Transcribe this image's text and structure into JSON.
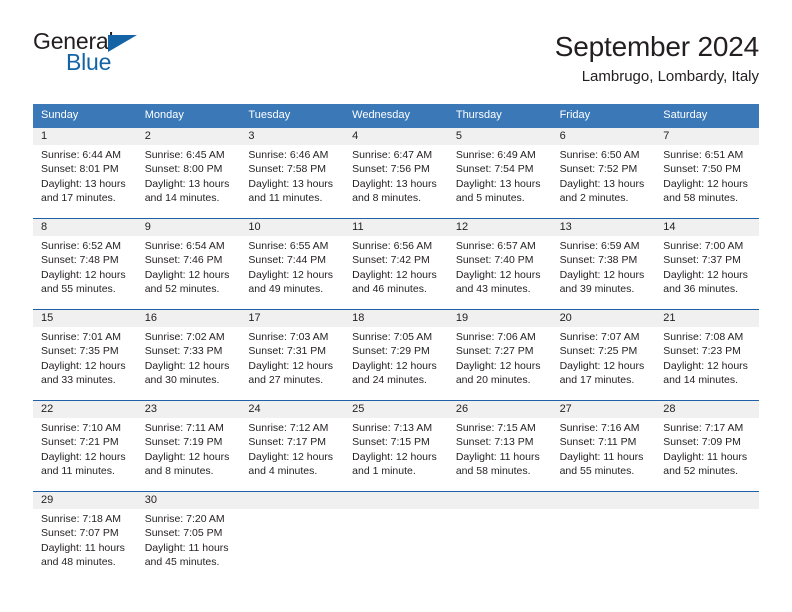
{
  "brand": {
    "word_one": "General",
    "word_two": "Blue",
    "triangle_color": "#1464a5"
  },
  "header": {
    "title": "September 2024",
    "subtitle": "Lambrugo, Lombardy, Italy"
  },
  "theme": {
    "header_row_bg": "#3a78b8",
    "week_divider": "#1f60a8",
    "daynum_band_bg": "#f0f0f0",
    "text": "#231f20"
  },
  "weekdays": [
    "Sunday",
    "Monday",
    "Tuesday",
    "Wednesday",
    "Thursday",
    "Friday",
    "Saturday"
  ],
  "weeks": [
    [
      {
        "day": "1",
        "sunrise": "Sunrise: 6:44 AM",
        "sunset": "Sunset: 8:01 PM",
        "daylight_1": "Daylight: 13 hours",
        "daylight_2": "and 17 minutes."
      },
      {
        "day": "2",
        "sunrise": "Sunrise: 6:45 AM",
        "sunset": "Sunset: 8:00 PM",
        "daylight_1": "Daylight: 13 hours",
        "daylight_2": "and 14 minutes."
      },
      {
        "day": "3",
        "sunrise": "Sunrise: 6:46 AM",
        "sunset": "Sunset: 7:58 PM",
        "daylight_1": "Daylight: 13 hours",
        "daylight_2": "and 11 minutes."
      },
      {
        "day": "4",
        "sunrise": "Sunrise: 6:47 AM",
        "sunset": "Sunset: 7:56 PM",
        "daylight_1": "Daylight: 13 hours",
        "daylight_2": "and 8 minutes."
      },
      {
        "day": "5",
        "sunrise": "Sunrise: 6:49 AM",
        "sunset": "Sunset: 7:54 PM",
        "daylight_1": "Daylight: 13 hours",
        "daylight_2": "and 5 minutes."
      },
      {
        "day": "6",
        "sunrise": "Sunrise: 6:50 AM",
        "sunset": "Sunset: 7:52 PM",
        "daylight_1": "Daylight: 13 hours",
        "daylight_2": "and 2 minutes."
      },
      {
        "day": "7",
        "sunrise": "Sunrise: 6:51 AM",
        "sunset": "Sunset: 7:50 PM",
        "daylight_1": "Daylight: 12 hours",
        "daylight_2": "and 58 minutes."
      }
    ],
    [
      {
        "day": "8",
        "sunrise": "Sunrise: 6:52 AM",
        "sunset": "Sunset: 7:48 PM",
        "daylight_1": "Daylight: 12 hours",
        "daylight_2": "and 55 minutes."
      },
      {
        "day": "9",
        "sunrise": "Sunrise: 6:54 AM",
        "sunset": "Sunset: 7:46 PM",
        "daylight_1": "Daylight: 12 hours",
        "daylight_2": "and 52 minutes."
      },
      {
        "day": "10",
        "sunrise": "Sunrise: 6:55 AM",
        "sunset": "Sunset: 7:44 PM",
        "daylight_1": "Daylight: 12 hours",
        "daylight_2": "and 49 minutes."
      },
      {
        "day": "11",
        "sunrise": "Sunrise: 6:56 AM",
        "sunset": "Sunset: 7:42 PM",
        "daylight_1": "Daylight: 12 hours",
        "daylight_2": "and 46 minutes."
      },
      {
        "day": "12",
        "sunrise": "Sunrise: 6:57 AM",
        "sunset": "Sunset: 7:40 PM",
        "daylight_1": "Daylight: 12 hours",
        "daylight_2": "and 43 minutes."
      },
      {
        "day": "13",
        "sunrise": "Sunrise: 6:59 AM",
        "sunset": "Sunset: 7:38 PM",
        "daylight_1": "Daylight: 12 hours",
        "daylight_2": "and 39 minutes."
      },
      {
        "day": "14",
        "sunrise": "Sunrise: 7:00 AM",
        "sunset": "Sunset: 7:37 PM",
        "daylight_1": "Daylight: 12 hours",
        "daylight_2": "and 36 minutes."
      }
    ],
    [
      {
        "day": "15",
        "sunrise": "Sunrise: 7:01 AM",
        "sunset": "Sunset: 7:35 PM",
        "daylight_1": "Daylight: 12 hours",
        "daylight_2": "and 33 minutes."
      },
      {
        "day": "16",
        "sunrise": "Sunrise: 7:02 AM",
        "sunset": "Sunset: 7:33 PM",
        "daylight_1": "Daylight: 12 hours",
        "daylight_2": "and 30 minutes."
      },
      {
        "day": "17",
        "sunrise": "Sunrise: 7:03 AM",
        "sunset": "Sunset: 7:31 PM",
        "daylight_1": "Daylight: 12 hours",
        "daylight_2": "and 27 minutes."
      },
      {
        "day": "18",
        "sunrise": "Sunrise: 7:05 AM",
        "sunset": "Sunset: 7:29 PM",
        "daylight_1": "Daylight: 12 hours",
        "daylight_2": "and 24 minutes."
      },
      {
        "day": "19",
        "sunrise": "Sunrise: 7:06 AM",
        "sunset": "Sunset: 7:27 PM",
        "daylight_1": "Daylight: 12 hours",
        "daylight_2": "and 20 minutes."
      },
      {
        "day": "20",
        "sunrise": "Sunrise: 7:07 AM",
        "sunset": "Sunset: 7:25 PM",
        "daylight_1": "Daylight: 12 hours",
        "daylight_2": "and 17 minutes."
      },
      {
        "day": "21",
        "sunrise": "Sunrise: 7:08 AM",
        "sunset": "Sunset: 7:23 PM",
        "daylight_1": "Daylight: 12 hours",
        "daylight_2": "and 14 minutes."
      }
    ],
    [
      {
        "day": "22",
        "sunrise": "Sunrise: 7:10 AM",
        "sunset": "Sunset: 7:21 PM",
        "daylight_1": "Daylight: 12 hours",
        "daylight_2": "and 11 minutes."
      },
      {
        "day": "23",
        "sunrise": "Sunrise: 7:11 AM",
        "sunset": "Sunset: 7:19 PM",
        "daylight_1": "Daylight: 12 hours",
        "daylight_2": "and 8 minutes."
      },
      {
        "day": "24",
        "sunrise": "Sunrise: 7:12 AM",
        "sunset": "Sunset: 7:17 PM",
        "daylight_1": "Daylight: 12 hours",
        "daylight_2": "and 4 minutes."
      },
      {
        "day": "25",
        "sunrise": "Sunrise: 7:13 AM",
        "sunset": "Sunset: 7:15 PM",
        "daylight_1": "Daylight: 12 hours",
        "daylight_2": "and 1 minute."
      },
      {
        "day": "26",
        "sunrise": "Sunrise: 7:15 AM",
        "sunset": "Sunset: 7:13 PM",
        "daylight_1": "Daylight: 11 hours",
        "daylight_2": "and 58 minutes."
      },
      {
        "day": "27",
        "sunrise": "Sunrise: 7:16 AM",
        "sunset": "Sunset: 7:11 PM",
        "daylight_1": "Daylight: 11 hours",
        "daylight_2": "and 55 minutes."
      },
      {
        "day": "28",
        "sunrise": "Sunrise: 7:17 AM",
        "sunset": "Sunset: 7:09 PM",
        "daylight_1": "Daylight: 11 hours",
        "daylight_2": "and 52 minutes."
      }
    ],
    [
      {
        "day": "29",
        "sunrise": "Sunrise: 7:18 AM",
        "sunset": "Sunset: 7:07 PM",
        "daylight_1": "Daylight: 11 hours",
        "daylight_2": "and 48 minutes."
      },
      {
        "day": "30",
        "sunrise": "Sunrise: 7:20 AM",
        "sunset": "Sunset: 7:05 PM",
        "daylight_1": "Daylight: 11 hours",
        "daylight_2": "and 45 minutes."
      },
      {
        "day": "",
        "sunrise": "",
        "sunset": "",
        "daylight_1": "",
        "daylight_2": ""
      },
      {
        "day": "",
        "sunrise": "",
        "sunset": "",
        "daylight_1": "",
        "daylight_2": ""
      },
      {
        "day": "",
        "sunrise": "",
        "sunset": "",
        "daylight_1": "",
        "daylight_2": ""
      },
      {
        "day": "",
        "sunrise": "",
        "sunset": "",
        "daylight_1": "",
        "daylight_2": ""
      },
      {
        "day": "",
        "sunrise": "",
        "sunset": "",
        "daylight_1": "",
        "daylight_2": ""
      }
    ]
  ]
}
